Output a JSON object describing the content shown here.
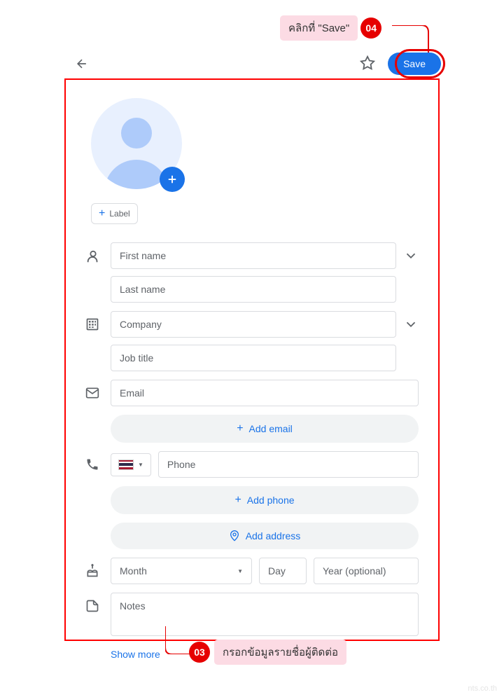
{
  "topbar": {
    "save_label": "Save"
  },
  "label_chip": {
    "text": "Label"
  },
  "fields": {
    "first_name": "First name",
    "last_name": "Last name",
    "company": "Company",
    "job_title": "Job title",
    "email": "Email",
    "add_email": "Add email",
    "phone": "Phone",
    "add_phone": "Add phone",
    "add_address": "Add address",
    "month": "Month",
    "day": "Day",
    "year": "Year (optional)",
    "notes": "Notes"
  },
  "show_more": "Show more",
  "callouts": {
    "c04_text": "คลิกที่ \"Save\"",
    "c04_num": "04",
    "c03_text": "กรอกข้อมูลรายชื่อผู้ติดต่อ",
    "c03_num": "03"
  },
  "watermark": "nts.co.th"
}
